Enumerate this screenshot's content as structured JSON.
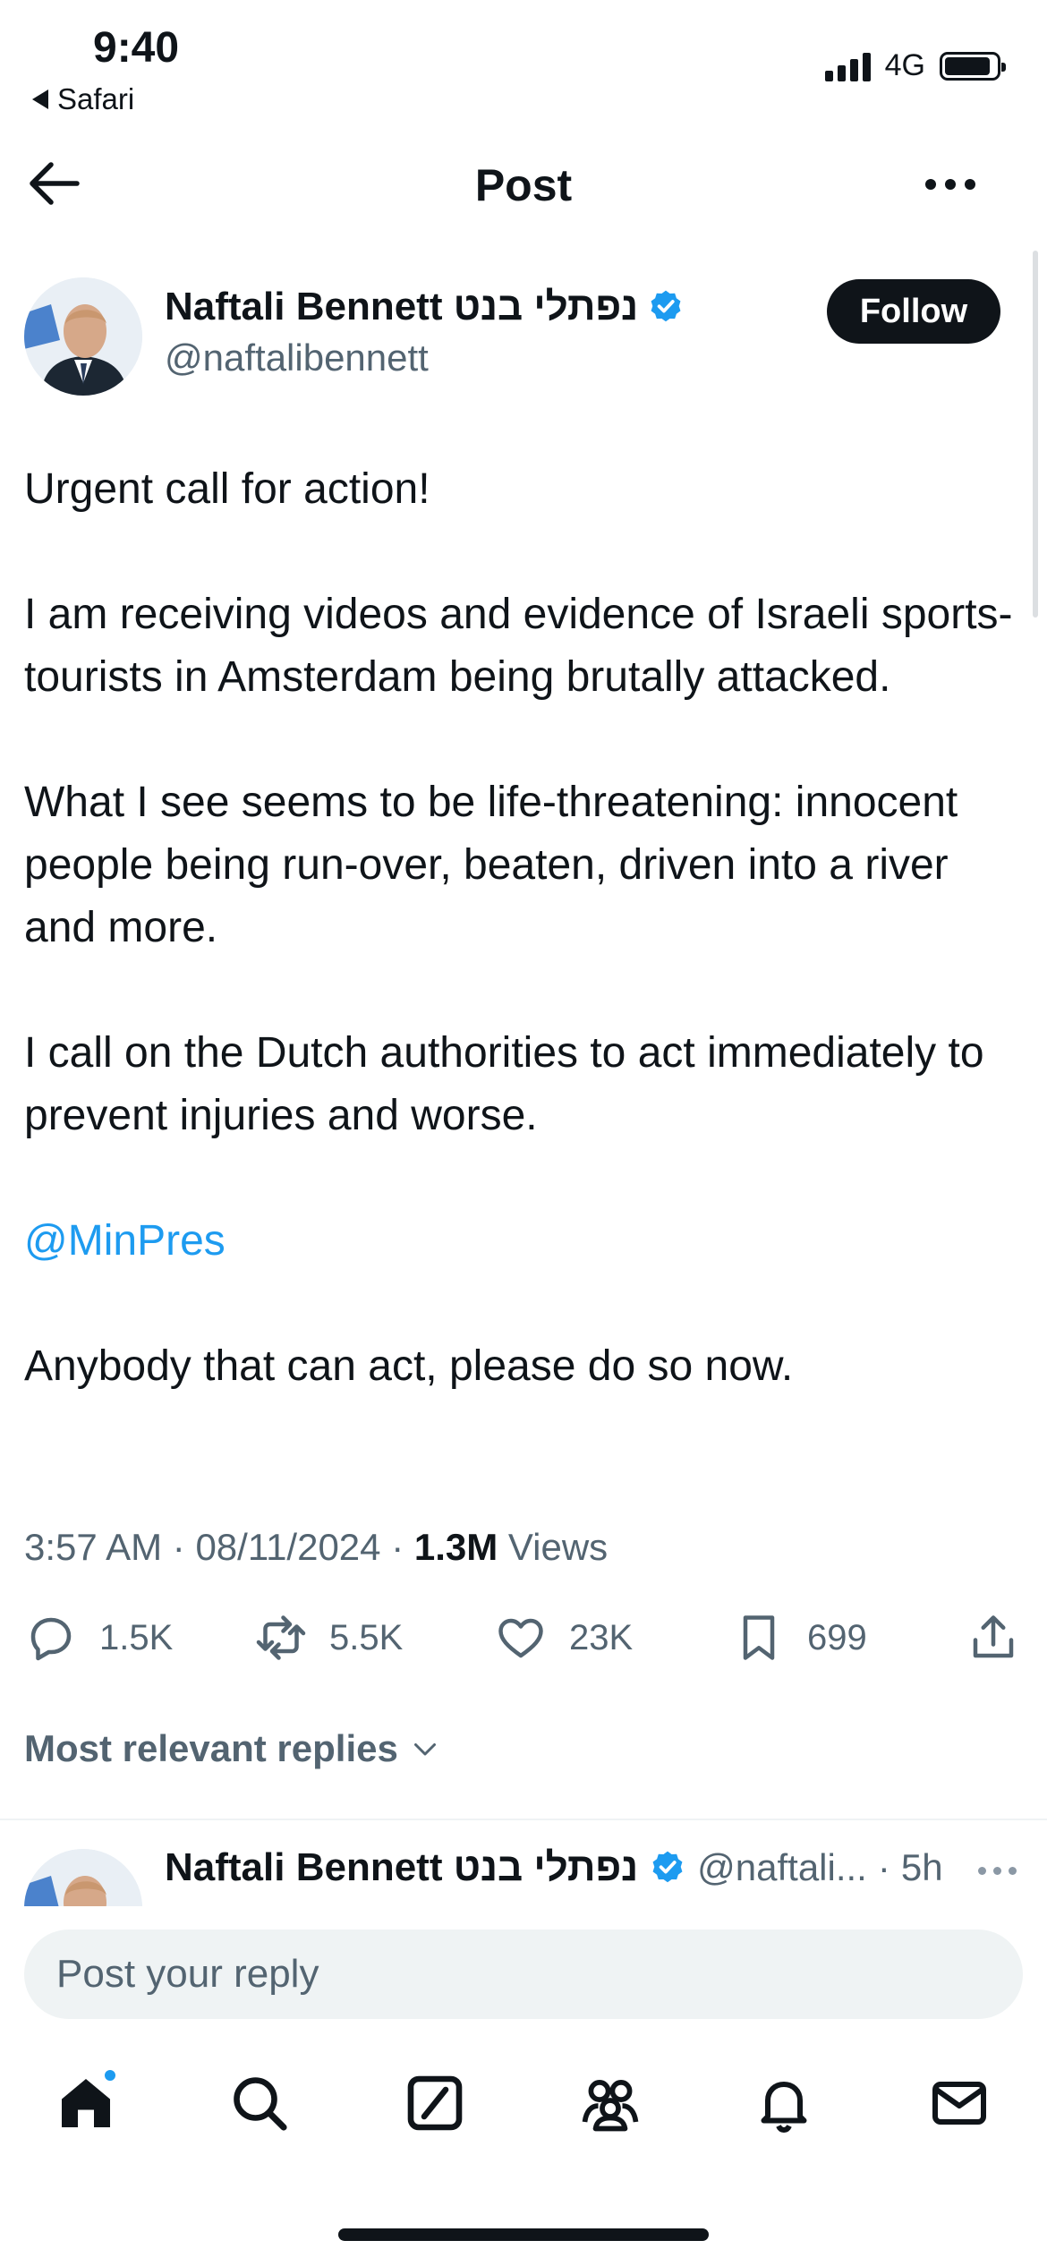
{
  "status_bar": {
    "time": "9:40",
    "back_app": "Safari",
    "network": "4G",
    "signal_bars": 4,
    "battery_level": 0.9
  },
  "header": {
    "title": "Post"
  },
  "author": {
    "name": "Naftali Bennett נפתלי בנט",
    "handle": "@naftalibennett",
    "verified": true,
    "follow_label": "Follow"
  },
  "tweet": {
    "paragraphs": [
      "Urgent call for action!",
      "I am receiving videos and evidence of Israeli sports-tourists in Amsterdam being brutally attacked.",
      "What I see seems to be life-threatening: innocent people being run-over, beaten, driven into a river and more.",
      "I call on the Dutch authorities to act immediately to prevent injuries and worse.",
      "@MinPres",
      "Anybody that can act, please do so now."
    ],
    "time": "3:57 AM",
    "date": "08/11/2024",
    "views_count": "1.3M",
    "views_label": "Views"
  },
  "actions": {
    "replies": "1.5K",
    "reposts": "5.5K",
    "likes": "23K",
    "bookmarks": "699"
  },
  "replies_sort": {
    "label": "Most relevant replies"
  },
  "reply_preview": {
    "name": "Naftali Bennett נפתלי בנט",
    "handle": "@naftali...",
    "separator": "·",
    "time": "5h"
  },
  "compose": {
    "placeholder": "Post your reply"
  },
  "colors": {
    "accent": "#1d9bf0",
    "text_primary": "#0f1419",
    "text_secondary": "#536471",
    "input_bg": "#eff3f4"
  },
  "nav": {
    "items": [
      "home-icon",
      "search-icon",
      "grok-icon",
      "communities-icon",
      "notifications-icon",
      "messages-icon"
    ],
    "home_has_notification_dot": true
  }
}
